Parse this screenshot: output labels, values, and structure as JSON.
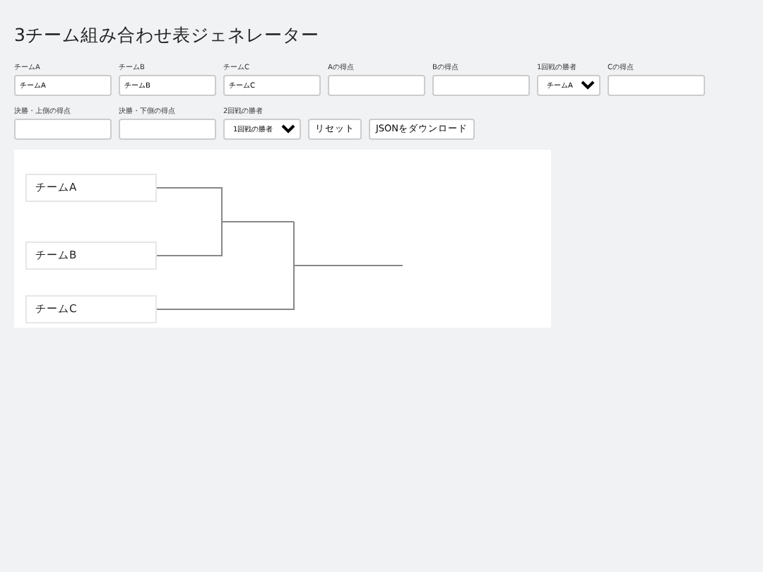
{
  "title": "3チーム組み合わせ表ジェネレーター",
  "rows": [
    [
      {
        "kind": "input",
        "label": "チームA",
        "value": "チームA"
      },
      {
        "kind": "input",
        "label": "チームB",
        "value": "チームB"
      },
      {
        "kind": "input",
        "label": "チームC",
        "value": "チームC"
      },
      {
        "kind": "input",
        "label": "Aの得点"
      },
      {
        "kind": "input",
        "label": "Bの得点"
      },
      {
        "kind": "select",
        "label": "1回戦の勝者",
        "value": "チームA"
      },
      {
        "kind": "input",
        "label": "Cの得点"
      }
    ],
    [
      {
        "kind": "input",
        "label": "決勝・上側の得点"
      },
      {
        "kind": "input",
        "label": "決勝・下側の得点"
      },
      {
        "kind": "select",
        "label": "2回戦の勝者",
        "value": "1回戦の勝者"
      },
      {
        "kind": "button",
        "value": "リセット"
      },
      {
        "kind": "button",
        "value": "JSONをダウンロード"
      }
    ]
  ],
  "bracket": {
    "teams": [
      "チームA",
      "チームB",
      "チームC"
    ]
  }
}
